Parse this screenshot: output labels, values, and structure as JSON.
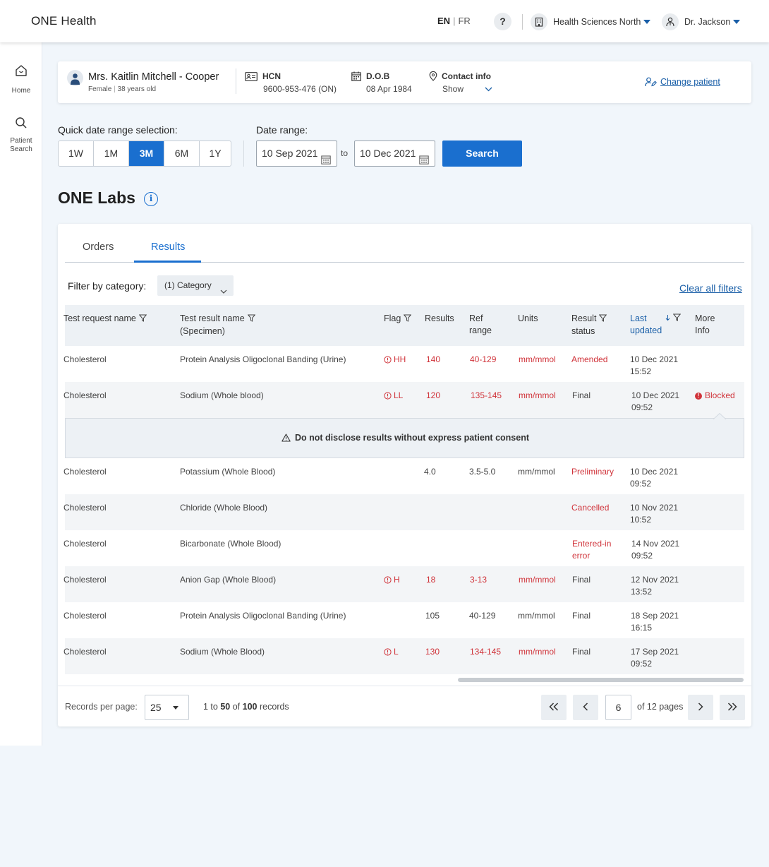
{
  "header": {
    "brand": "ONE Health",
    "lang_active": "EN",
    "lang_sep": "|",
    "lang_inactive": "FR",
    "help_label": "?",
    "organization": "Health Sciences North",
    "user": "Dr. Jackson"
  },
  "sidebar": {
    "items": [
      {
        "label": "Home",
        "icon": "home-icon"
      },
      {
        "label": "Patient Search",
        "icon": "search-icon"
      }
    ]
  },
  "patient": {
    "name": "Mrs. Kaitlin Mitchell - Cooper",
    "gender": "Female",
    "age": "38 years old",
    "hcn_label": "HCN",
    "hcn_value": "9600-953-476 (ON)",
    "dob_label": "D.O.B",
    "dob_value": "08 Apr 1984",
    "contact_label": "Contact info",
    "contact_value": "Show",
    "change_label": "Change patient"
  },
  "date_selection": {
    "quick_label": "Quick date range selection:",
    "ranges": [
      "1W",
      "1M",
      "3M",
      "6M",
      "1Y"
    ],
    "active_range": "3M",
    "range_label": "Date range:",
    "from": "10 Sep 2021",
    "to_label": "to",
    "to": "10 Dec 2021",
    "search_label": "Search"
  },
  "labs": {
    "title": "ONE Labs",
    "info_label": "i",
    "tabs": [
      {
        "label": "Orders",
        "active": false
      },
      {
        "label": "Results",
        "active": true
      }
    ],
    "filter_label": "Filter by category:",
    "category_button": "(1) Category",
    "clear_filters": "Clear all filters",
    "columns": {
      "test_request": "Test request name",
      "test_result": "Test result name",
      "specimen": "(Specimen)",
      "flag": "Flag",
      "results": "Results",
      "ref": "Ref",
      "range": "range",
      "units": "Units",
      "result": "Result",
      "status": "status",
      "last": "Last",
      "updated": "updated",
      "more": "More",
      "info": "Info"
    },
    "rows": [
      {
        "request": "Cholesterol",
        "result_name": "Protein Analysis Oligoclonal Banding (Urine)",
        "flag": "HH",
        "value": "140",
        "ref": "40-129",
        "units": "mm/mmol",
        "status": "Amended",
        "date": "10 Dec 2021",
        "time": "15:52",
        "more": ""
      },
      {
        "request": "Cholesterol",
        "result_name": "Sodium (Whole blood)",
        "flag": "LL",
        "value": "120",
        "ref": "135-145",
        "units": "mm/mmol",
        "status": "Final",
        "date": "10 Dec 2021",
        "time": "09:52",
        "more": "Blocked"
      },
      {
        "request": "Cholesterol",
        "result_name": "Potassium (Whole Blood)",
        "flag": "",
        "value": "4.0",
        "ref": "3.5-5.0",
        "units": "mm/mmol",
        "status": "Preliminary",
        "date": "10 Dec 2021",
        "time": "09:52",
        "more": ""
      },
      {
        "request": "Cholesterol",
        "result_name": "Chloride (Whole Blood)",
        "flag": "",
        "value": "",
        "ref": "",
        "units": "",
        "status": "Cancelled",
        "date": "10 Nov 2021",
        "time": "10:52",
        "more": ""
      },
      {
        "request": "Cholesterol",
        "result_name": "Bicarbonate (Whole Blood)",
        "flag": "",
        "value": "",
        "ref": "",
        "units": "",
        "status_line1": "Entered-in",
        "status_line2": "error",
        "date": "14 Nov 2021",
        "time": "09:52",
        "more": ""
      },
      {
        "request": "Cholesterol",
        "result_name": "Anion Gap (Whole Blood)",
        "flag": "H",
        "value": "18",
        "ref": "3-13",
        "units": "mm/mmol",
        "status": "Final",
        "date": "12 Nov 2021",
        "time": "13:52",
        "more": ""
      },
      {
        "request": "Cholesterol",
        "result_name": "Protein Analysis Oligoclonal Banding (Urine)",
        "flag": "",
        "value": "105",
        "ref": "40-129",
        "units": "mm/mmol",
        "status": "Final",
        "date": "18 Sep 2021",
        "time": "16:15",
        "more": ""
      },
      {
        "request": "Cholesterol",
        "result_name": "Sodium (Whole Blood)",
        "flag": "L",
        "value": "130",
        "ref": "134-145",
        "units": "mm/mmol",
        "status": "Final",
        "date": "17 Sep 2021",
        "time": "09:52",
        "more": ""
      }
    ],
    "warning": "Do not disclose results without express patient consent"
  },
  "pagination": {
    "rpp_label": "Records per page:",
    "rpp_value": "25",
    "range_text": "1 to",
    "range_end": "50",
    "of_text": "of",
    "total": "100",
    "records_word": "records",
    "page": "6",
    "of_pages": "of 12 pages"
  },
  "colors": {
    "accent": "#1a6fcf",
    "danger": "#d0333a",
    "background": "#f1f6fb"
  }
}
